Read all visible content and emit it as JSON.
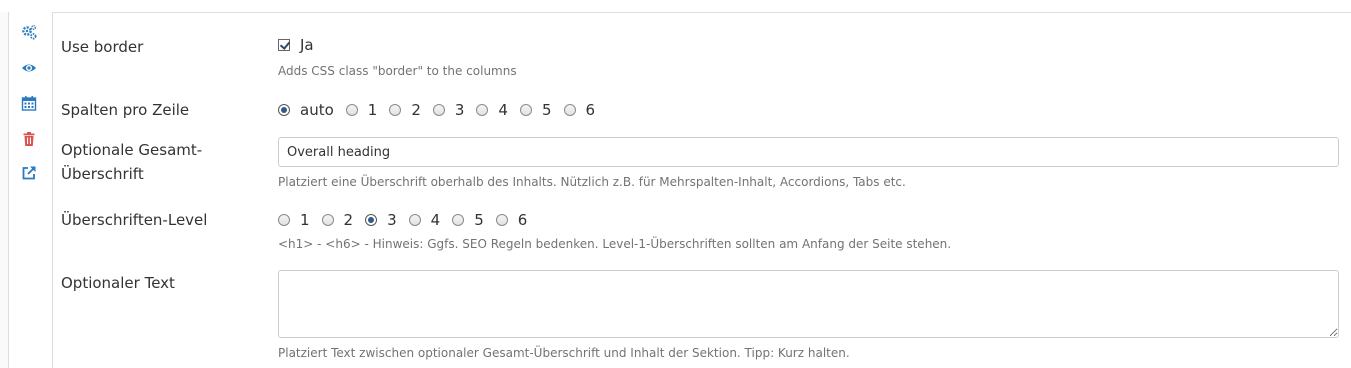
{
  "sidebar": {
    "icons": [
      "cogs-icon",
      "eye-icon",
      "calendar-icon",
      "trash-icon",
      "external-link-icon"
    ],
    "colors": {
      "blue": "#2a7ac0",
      "red": "#d9534f"
    }
  },
  "fields": {
    "use_border": {
      "label": "Use border",
      "checkbox_label": "Ja",
      "checked": true,
      "help": "Adds CSS class \"border\" to the columns"
    },
    "spalten": {
      "label": "Spalten pro Zeile",
      "options": [
        "auto",
        "1",
        "2",
        "3",
        "4",
        "5",
        "6"
      ],
      "selected": "auto"
    },
    "heading": {
      "label_line1": "Optionale Gesamt-",
      "label_line2": "Überschrift",
      "value": "Overall heading",
      "help": "Platziert eine Überschrift oberhalb des Inhalts. Nützlich z.B. für Mehrspalten-Inhalt, Accordions, Tabs etc."
    },
    "level": {
      "label": "Überschriften-Level",
      "options": [
        "1",
        "2",
        "3",
        "4",
        "5",
        "6"
      ],
      "selected": "3",
      "help": "<h1> - <h6> - Hinweis: Ggfs. SEO Regeln bedenken. Level-1-Überschriften sollten am Anfang der Seite stehen."
    },
    "text": {
      "label": "Optionaler Text",
      "value": "",
      "help": "Platziert Text zwischen optionaler Gesamt-Überschrift und Inhalt der Sektion. Tipp: Kurz halten."
    }
  }
}
